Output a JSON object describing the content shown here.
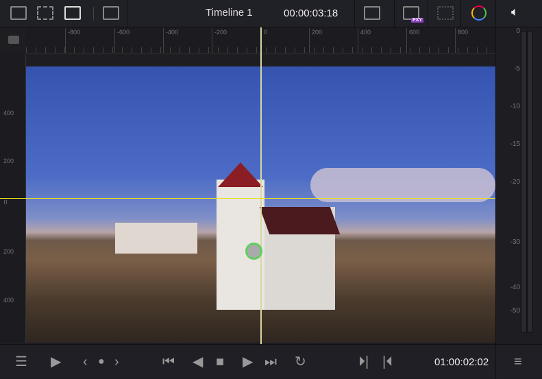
{
  "toolbar": {
    "timeline_name": "Timeline 1",
    "timecode": "00:00:03:18",
    "proxy_badge": "PXY"
  },
  "ruler": {
    "horizontal": [
      "-800",
      "-600",
      "-400",
      "-200",
      "0",
      "200",
      "400",
      "600",
      "800"
    ],
    "vertical": [
      "400",
      "200",
      "0",
      "200",
      "400"
    ]
  },
  "audio_meter": {
    "labels": [
      "0",
      "-5",
      "-10",
      "-15",
      "-20",
      "-30",
      "-40",
      "-50"
    ],
    "level_db": null
  },
  "transport": {
    "timecode": "01:00:02:02"
  },
  "colors": {
    "crosshair_v": "#d8d8a0",
    "crosshair_h": "#e8e020",
    "tracker": "#5fcf5f"
  }
}
